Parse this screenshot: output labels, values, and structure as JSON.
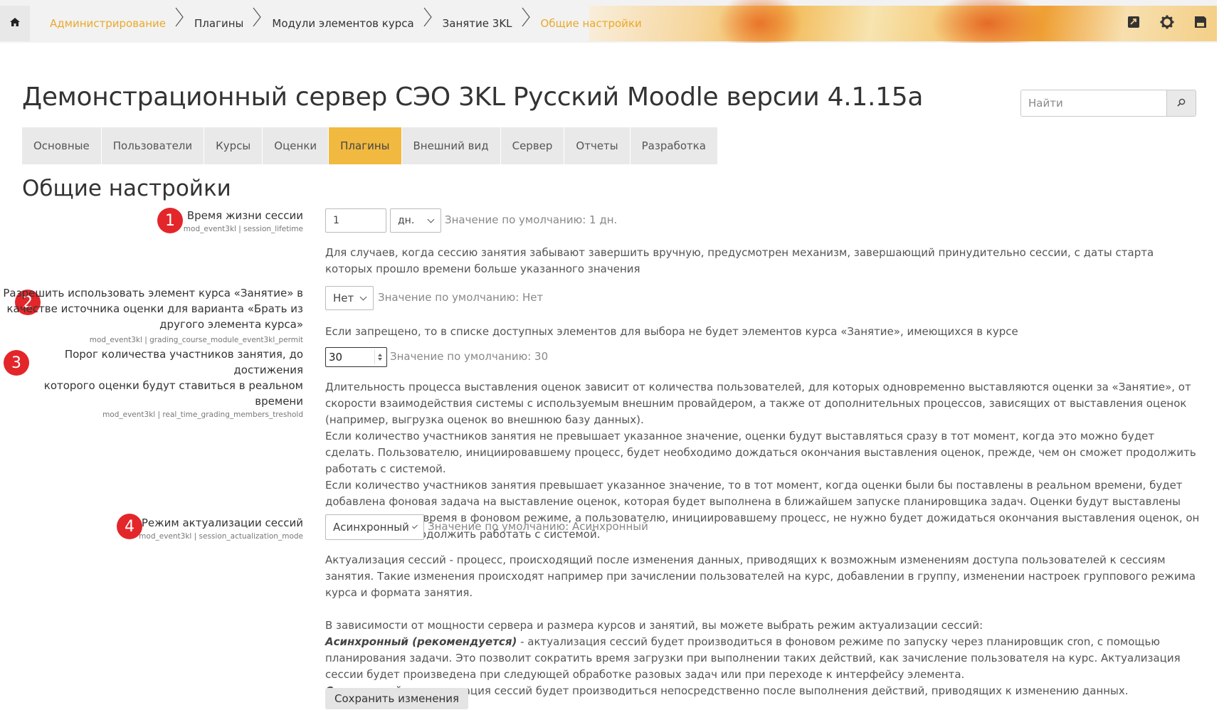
{
  "breadcrumbs": [
    {
      "label": "Администрирование",
      "style": "link"
    },
    {
      "label": "Плагины",
      "style": "plain"
    },
    {
      "label": "Модули элементов курса",
      "style": "plain"
    },
    {
      "label": "Занятие 3KL",
      "style": "plain"
    },
    {
      "label": "Общие настройки",
      "style": "current"
    }
  ],
  "top_icons": [
    "home-icon",
    "send-icon",
    "gear-icon",
    "save-disk-icon"
  ],
  "site_title": "Демонстрационный сервер СЭО 3KL Русский Moodle версии 4.1.15a",
  "search": {
    "placeholder": "Найти"
  },
  "tabs": [
    {
      "label": "Основные",
      "active": false
    },
    {
      "label": "Пользователи",
      "active": false
    },
    {
      "label": "Курсы",
      "active": false
    },
    {
      "label": "Оценки",
      "active": false
    },
    {
      "label": "Плагины",
      "active": true
    },
    {
      "label": "Внешний вид",
      "active": false
    },
    {
      "label": "Сервер",
      "active": false
    },
    {
      "label": "Отчеты",
      "active": false
    },
    {
      "label": "Разработка",
      "active": false
    }
  ],
  "page_heading": "Общие настройки",
  "settings": {
    "s1": {
      "badge": "1",
      "title": "Время жизни сессии",
      "key": "mod_event3kl | session_lifetime",
      "value": "1",
      "unit": "дн.",
      "default": "Значение по умолчанию: 1 дн.",
      "description": "Для случаев, когда сессию занятия забывают завершить вручную, предусмотрен механизм, завершающий принудительно сессии, с даты старта которых прошло времени больше указанного значения"
    },
    "s2": {
      "badge": "2",
      "title_l1": "Разрешить использовать элемент курса «Занятие» в",
      "title_l2": "качестве источника оценки для варианта «Брать из",
      "title_l3": "другого элемента курса»",
      "key": "mod_event3kl | grading_course_module_event3kl_permit",
      "value": "Нет",
      "default": "Значение по умолчанию: Нет",
      "description": "Если запрещено, то в списке доступных элементов для выбора не будет элементов курса «Занятие», имеющихся в курсе"
    },
    "s3": {
      "badge": "3",
      "title_l1": "Порог количества участников занятия, до достижения",
      "title_l2": "которого оценки будут ставиться в реальном времени",
      "key": "mod_event3kl | real_time_grading_members_treshold",
      "value": "30",
      "default": "Значение по умолчанию: 30",
      "description_p1": "Длительность процесса выставления оценок зависит от количества пользователей, для которых одновременно выставляются оценки за «Занятие», от скорости взаимодействия системы с используемым внешним провайдером, а также от дополнительных процессов, зависящих от выставления оценок (например, выгрузка оценок во внешнюю базу данных).",
      "description_p2": "Если количество участников занятия не превышает указанное значение, оценки будут выставляться сразу в тот момент, когда это можно будет сделать. Пользователю, инициировавшему процесс, будет необходимо дождаться окончания выставления оценок, прежде, чем он сможет продолжить работать с системой.",
      "description_p3": "Если количество участников занятия превышает указанное значение, то в тот момент, когда оценки были бы поставлены в реальном времени, будет добавлена фоновая задача на выставление оценок, которая будет выполнена в ближайшем запуске планировщика задач. Оценки будут выставлены через некоторое время в фоновом режиме, а пользователю, инициировавшему процесс, не нужно будет дожидаться окончания выставления оценок, он сможет сразу продолжить работать с системой."
    },
    "s4": {
      "badge": "4",
      "title": "Режим актуализации сессий",
      "key": "mod_event3kl | session_actualization_mode",
      "value": "Асинхронный",
      "default": "Значение по умолчанию: Асинхронный",
      "description_p1": "Актуализация сессий - процесс, происходящий после изменения данных, приводящих к возможным изменениям доступа пользователей к сессиям занятия. Такие изменения происходят например при зачислении пользователей на курс, добавлении в группу, изменении настроек группового режима курса и формата занятия.",
      "description_p2": "В зависимости от мощности сервера и размера курсов и занятий, вы можете выбрать режим актуализации сессий:",
      "async_em": "Асинхронный (рекомендуется)",
      "async_text": " - актуализация сессий будет производиться в фоновом режиме по запуску через планировщик cron, с помощью планирования задачи. Это позволит сократить время загрузки при выполнении таких действий, как зачисление пользователя на курс. Актуализация сессии будет произведена при следующей обработке разовых задач или при переходе к интерфейсу элемента.",
      "sync_em": "Синхронный",
      "sync_text": " - актуализация сессий будет производиться непосредственно после выполнения действий, приводящих к изменению данных."
    }
  },
  "save_button": "Сохранить изменения",
  "colors": {
    "accent": "#f1b940",
    "link": "#e9a92a",
    "badge": "#e3262a"
  }
}
